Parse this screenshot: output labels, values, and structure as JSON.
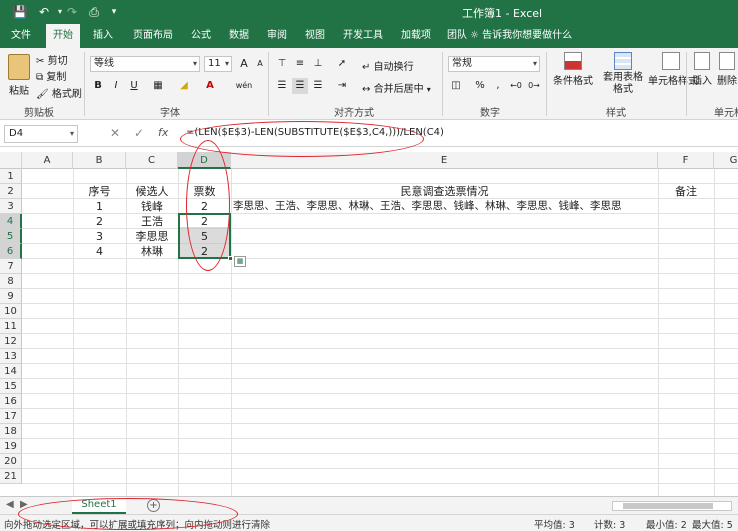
{
  "window": {
    "title": "工作簿1 - Excel"
  },
  "tabs": [
    "文件",
    "开始",
    "插入",
    "页面布局",
    "公式",
    "数据",
    "审阅",
    "视图",
    "开发工具",
    "加载项",
    "团队"
  ],
  "active_tab_index": 1,
  "tell_me": "告诉我你想要做什么",
  "ribbon": {
    "clipboard": {
      "paste": "粘贴",
      "cut": "剪切",
      "copy": "复制",
      "format_painter": "格式刷",
      "group": "剪贴板"
    },
    "font": {
      "name": "等线",
      "size": "11",
      "group": "字体",
      "bold": "B",
      "italic": "I",
      "underline": "U",
      "grow": "A",
      "shrink": "A",
      "phonetic": "wén"
    },
    "alignment": {
      "wrap": "自动换行",
      "merge": "合并后居中",
      "group": "对齐方式"
    },
    "number": {
      "format": "常规",
      "group": "数字",
      "percent": "%",
      "comma": ","
    },
    "styles": {
      "conditional": "条件格式",
      "table": "套用表格格式",
      "cell_styles": "单元格样式",
      "group": "样式"
    },
    "cells": {
      "insert": "插入",
      "delete": "删除",
      "group": "单元格"
    }
  },
  "formula_bar": {
    "name_box": "D4",
    "fx": "fx",
    "formula": "=(LEN($E$3)-LEN(SUBSTITUTE($E$3,C4,)))/LEN(C4)"
  },
  "columns": [
    "A",
    "B",
    "C",
    "D",
    "E",
    "F",
    "G"
  ],
  "rows": [
    "1",
    "2",
    "3",
    "4",
    "5",
    "6",
    "7",
    "8",
    "9",
    "10",
    "11",
    "12",
    "13",
    "14",
    "15",
    "16",
    "17",
    "18",
    "19",
    "20",
    "21"
  ],
  "header_row": {
    "b": "序号",
    "c": "候选人",
    "d": "票数",
    "e": "民意调查选票情况",
    "f": "备注"
  },
  "data_rows": [
    {
      "b": "1",
      "c": "钱峰",
      "d": "2",
      "e": "李思思、王浩、李思思、林琳、王浩、李思思、钱峰、林琳、李思思、钱峰、李思思"
    },
    {
      "b": "2",
      "c": "王浩",
      "d": "2",
      "e": ""
    },
    {
      "b": "3",
      "c": "李思思",
      "d": "5",
      "e": ""
    },
    {
      "b": "4",
      "c": "林琳",
      "d": "2",
      "e": ""
    }
  ],
  "sheet": {
    "name": "Sheet1",
    "add": "+"
  },
  "status": {
    "message": "向外拖动选定区域，可以扩展或填充序列；向内拖动则进行清除",
    "average": "平均值: 3",
    "count": "计数: 3",
    "min": "最小值: 2",
    "max": "最大值: 5"
  },
  "colors": {
    "brand": "#217346",
    "annotation": "#e0242b",
    "selection": "#d3d3d3"
  }
}
